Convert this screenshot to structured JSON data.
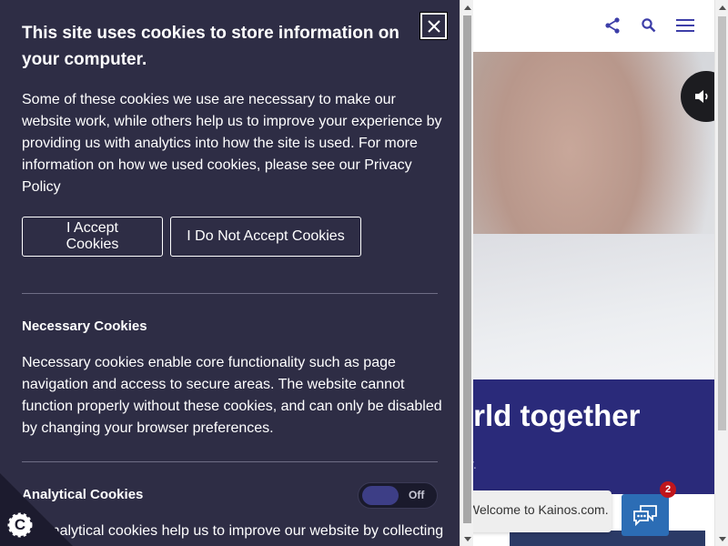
{
  "site": {
    "banner_title": "orld together",
    "banner_subtitle": "gy.",
    "chat_greeting": "Welcome to Kainos.com.",
    "chat_badge_count": "2",
    "icons": [
      "share-icon",
      "search-icon",
      "menu-icon",
      "volume-icon",
      "chat-icon"
    ],
    "colors": {
      "banner": "#2a2a7a",
      "chat_button": "#2c6db5",
      "header_icon": "#3d3ea8"
    }
  },
  "cookie_panel": {
    "title": "This site uses cookies to store information on your computer.",
    "intro": "Some of these cookies we use are necessary to make our website work, while others help us to improve your experience by providing us with analytics into how the site is used. For more information on how we used cookies, please see our Privacy Policy",
    "accept_label": "I Accept Cookies",
    "decline_label": "I Do Not Accept Cookies",
    "necessary_title": "Necessary Cookies",
    "necessary_text": "Necessary cookies enable core functionality such as page navigation and access to secure areas. The website cannot function properly without these cookies, and can only be disabled by changing your browser preferences.",
    "analytical_title": "Analytical Cookies",
    "analytical_toggle_state": "Off",
    "analytical_text": "Analytical cookies help us to improve our website by collecting",
    "badge_letter": "C",
    "colors": {
      "panel_bg": "#2e2d45",
      "text": "#ffffff",
      "toggle_knob": "#3d3e86"
    }
  }
}
